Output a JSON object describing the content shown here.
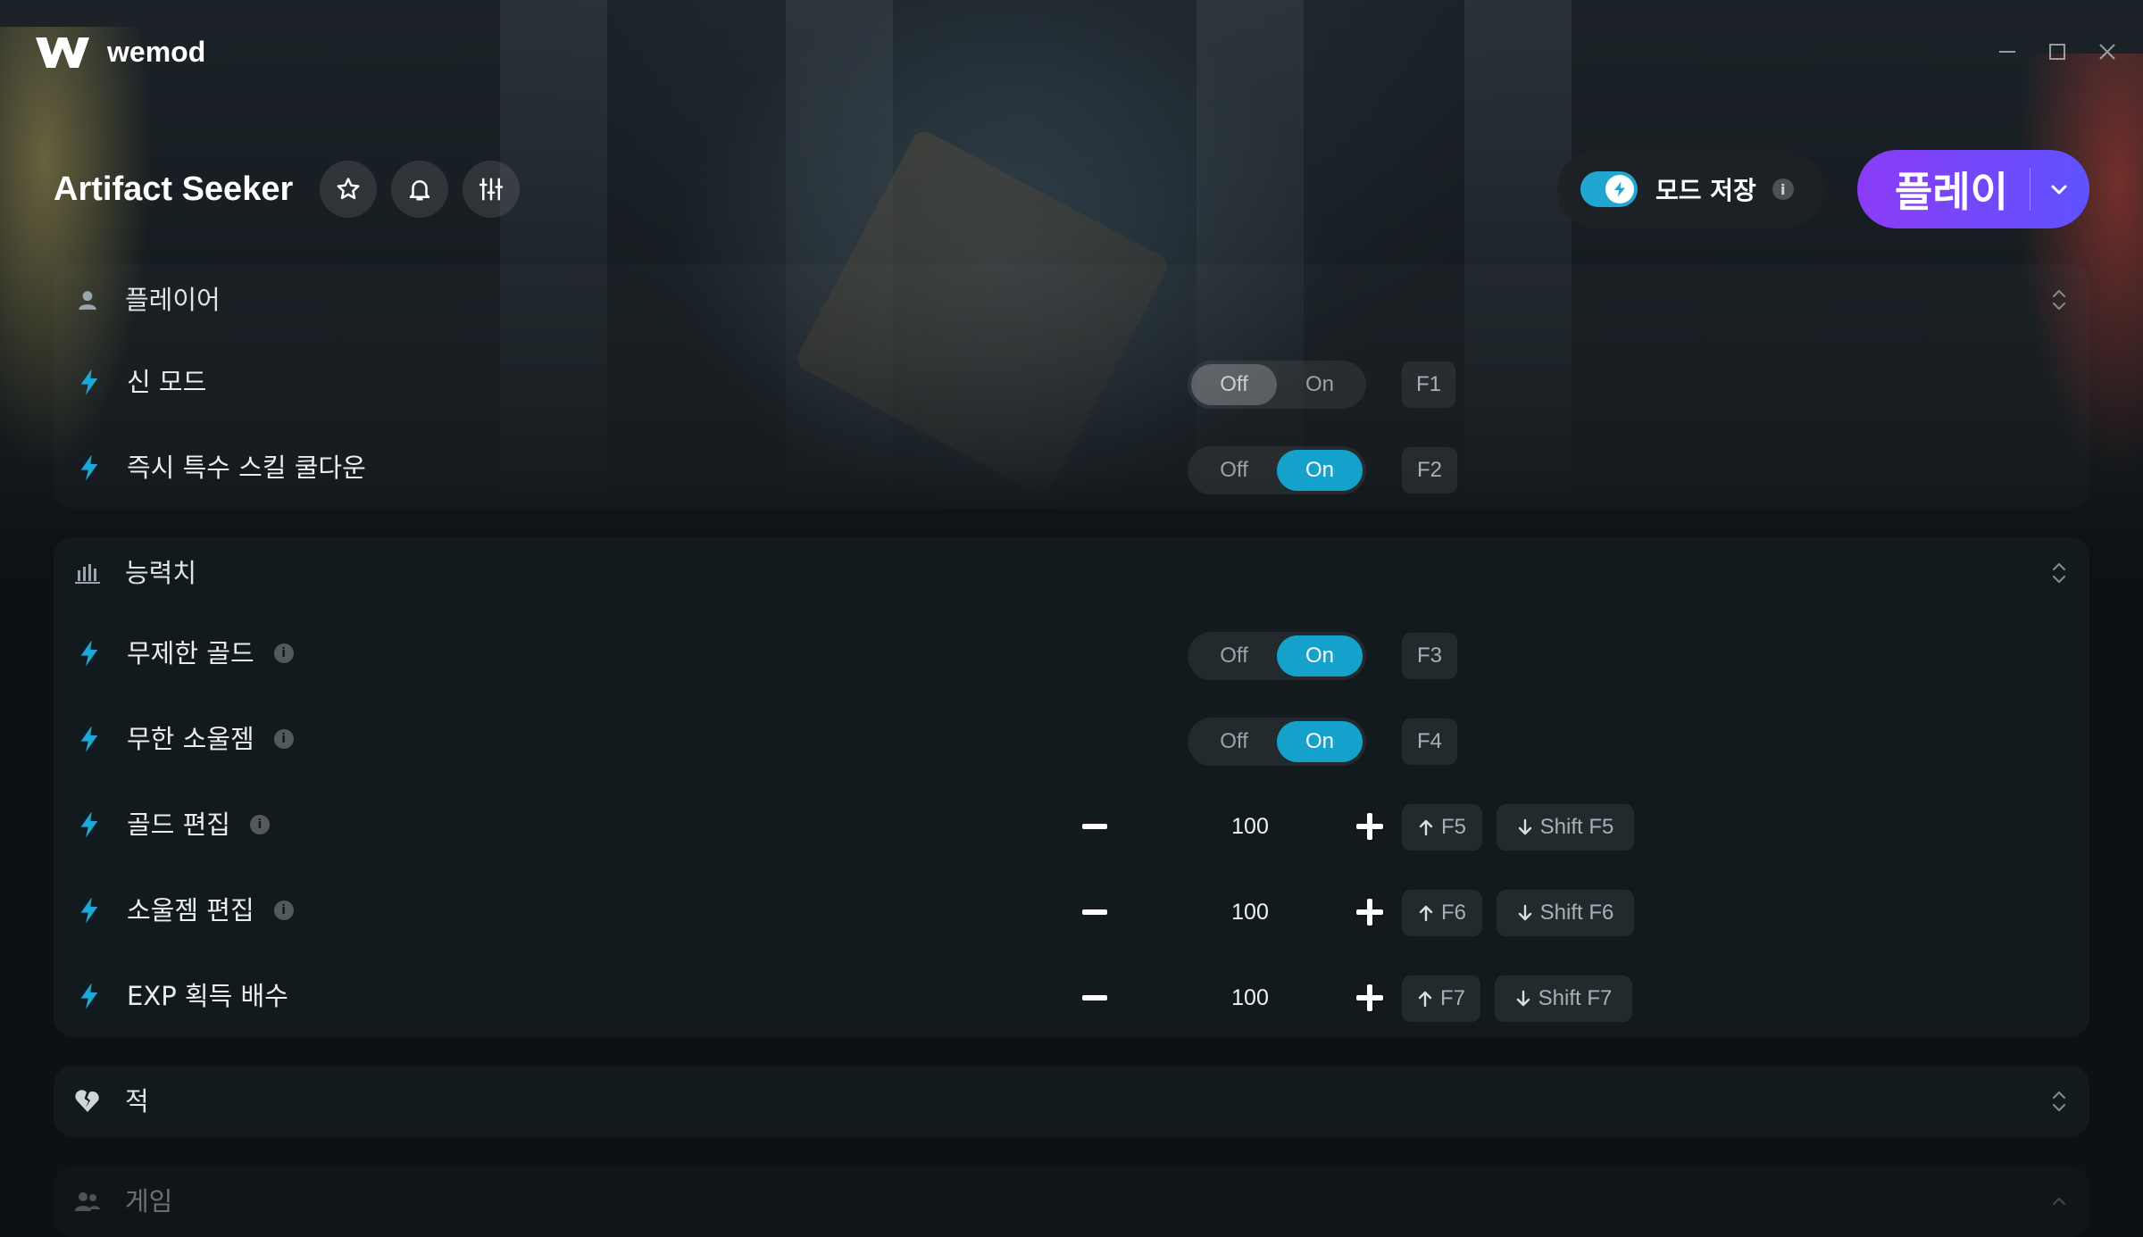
{
  "brand": {
    "name": "wemod"
  },
  "game": {
    "title": "Artifact Seeker"
  },
  "header": {
    "save_mods_label": "모드 저장",
    "save_mods_info": "i",
    "play_label": "플레이"
  },
  "sections": [
    {
      "title": "플레이어",
      "icon": "person-icon",
      "mods": [
        {
          "label": "신 모드",
          "type": "toggle",
          "off": "Off",
          "on": "On",
          "state": "off",
          "key": "F1"
        },
        {
          "label": "즉시 특수 스킬 쿨다운",
          "type": "toggle",
          "off": "Off",
          "on": "On",
          "state": "on",
          "key": "F2"
        }
      ]
    },
    {
      "title": "능력치",
      "icon": "bar-chart-icon",
      "mods": [
        {
          "label": "무제한 골드",
          "info": "i",
          "type": "toggle",
          "off": "Off",
          "on": "On",
          "state": "on",
          "key": "F3"
        },
        {
          "label": "무한 소울젬",
          "info": "i",
          "type": "toggle",
          "off": "Off",
          "on": "On",
          "state": "on",
          "key": "F4"
        },
        {
          "label": "골드 편집",
          "info": "i",
          "type": "number",
          "value": "100",
          "inc_key": "F5",
          "dec_key": "Shift F5"
        },
        {
          "label": "소울젬 편집",
          "info": "i",
          "type": "number",
          "value": "100",
          "inc_key": "F6",
          "dec_key": "Shift F6"
        },
        {
          "label": "EXP 획득 배수",
          "type": "number",
          "value": "100",
          "inc_key": "F7",
          "dec_key": "Shift F7"
        }
      ]
    },
    {
      "title": "적",
      "icon": "broken-heart-icon"
    },
    {
      "title": "게임",
      "icon": "group-icon"
    }
  ],
  "colors": {
    "accent": "#14a2cc",
    "play_start": "#8b3cf5",
    "play_end": "#5f52ff"
  }
}
